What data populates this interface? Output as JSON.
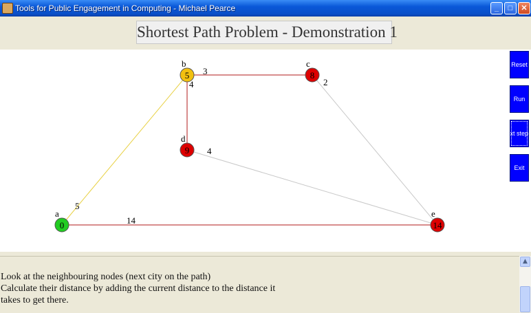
{
  "window": {
    "title": "Tools for Public Engagement in Computing - Michael Pearce"
  },
  "header": {
    "title": "Shortest Path Problem - Demonstration 1"
  },
  "colors": {
    "visited": "#22cc22",
    "current": "#f2c010",
    "unvisited": "#dd0000",
    "buttons": "#0000ff"
  },
  "graph": {
    "nodes": [
      {
        "id": "a",
        "value": "0",
        "state": "visited"
      },
      {
        "id": "b",
        "value": "5",
        "state": "current"
      },
      {
        "id": "c",
        "value": "8",
        "state": "unvisited"
      },
      {
        "id": "d",
        "value": "9",
        "state": "unvisited"
      },
      {
        "id": "e",
        "value": "14",
        "state": "unvisited"
      }
    ],
    "edges": [
      {
        "from": "a",
        "to": "b",
        "weight": "5",
        "state": "highlight"
      },
      {
        "from": "a",
        "to": "e",
        "weight": "14",
        "state": "active"
      },
      {
        "from": "b",
        "to": "c",
        "weight": "3",
        "state": "active"
      },
      {
        "from": "b",
        "to": "d",
        "weight": "4",
        "state": "active"
      },
      {
        "from": "c",
        "to": "e",
        "weight": "2",
        "state": "idle"
      },
      {
        "from": "d",
        "to": "e",
        "weight": "4",
        "state": "idle"
      }
    ]
  },
  "controls": {
    "reset": "Reset",
    "run": "Run",
    "next_step": "Next step",
    "exit": "Exit"
  },
  "message": {
    "line1": "Look at the neighbouring nodes (next city on the path)",
    "line2": "Calculate their distance by adding the current distance to the distance it",
    "line3": "takes to get there."
  }
}
